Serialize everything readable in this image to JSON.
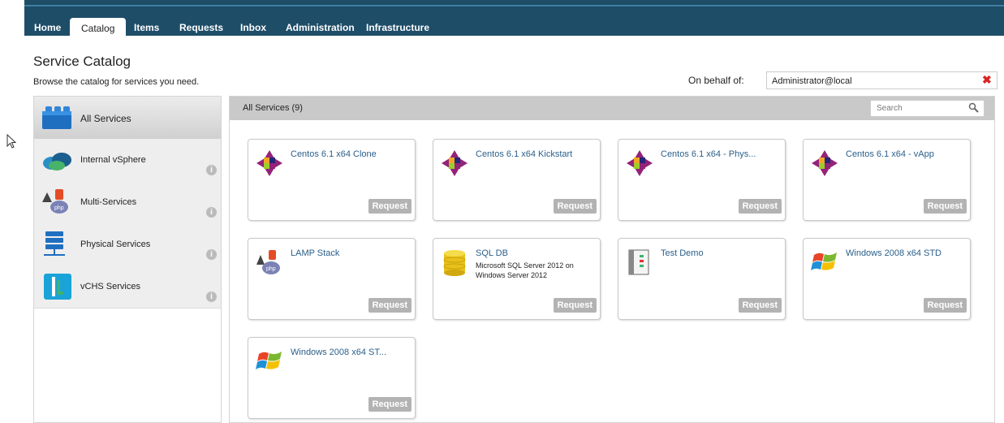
{
  "nav": {
    "tabs": [
      {
        "label": "Home"
      },
      {
        "label": "Catalog"
      },
      {
        "label": "Items"
      },
      {
        "label": "Requests"
      },
      {
        "label": "Inbox"
      },
      {
        "label": "Administration"
      },
      {
        "label": "Infrastructure"
      }
    ],
    "active": "Catalog"
  },
  "header": {
    "title": "Service Catalog",
    "subtitle": "Browse the catalog for services you need."
  },
  "behalf": {
    "label": "On behalf of:",
    "value": "Administrator@local",
    "clear_icon": "close-icon"
  },
  "sidebar": {
    "items": [
      {
        "label": "All Services",
        "icon": "lego-blocks-icon"
      },
      {
        "label": "Internal vSphere",
        "icon": "vsphere-icon"
      },
      {
        "label": "Multi-Services",
        "icon": "php-stack-icon"
      },
      {
        "label": "Physical Services",
        "icon": "server-icon"
      },
      {
        "label": "vCHS Services",
        "icon": "vchs-icon"
      }
    ],
    "info_glyph": "i"
  },
  "main": {
    "title": "All Services (9)",
    "search_placeholder": "Search",
    "request_label": "Request",
    "cards": [
      {
        "title": "Centos 6.1 x64 Clone",
        "desc": "",
        "icon": "centos-icon"
      },
      {
        "title": "Centos 6.1 x64 Kickstart",
        "desc": "",
        "icon": "centos-icon"
      },
      {
        "title": "Centos 6.1 x64 - Phys...",
        "desc": "",
        "icon": "centos-icon"
      },
      {
        "title": "Centos 6.1 x64 - vApp",
        "desc": "",
        "icon": "centos-icon"
      },
      {
        "title": "LAMP Stack",
        "desc": "",
        "icon": "php-stack-icon"
      },
      {
        "title": "SQL DB",
        "desc": "Microsoft SQL Server 2012 on Windows Server 2012",
        "icon": "database-icon"
      },
      {
        "title": "Test Demo",
        "desc": "",
        "icon": "server-rack-icon"
      },
      {
        "title": "Windows 2008 x64 STD",
        "desc": "",
        "icon": "windows-icon"
      },
      {
        "title": "Windows 2008 x64 ST...",
        "desc": "",
        "icon": "windows-icon"
      }
    ]
  }
}
